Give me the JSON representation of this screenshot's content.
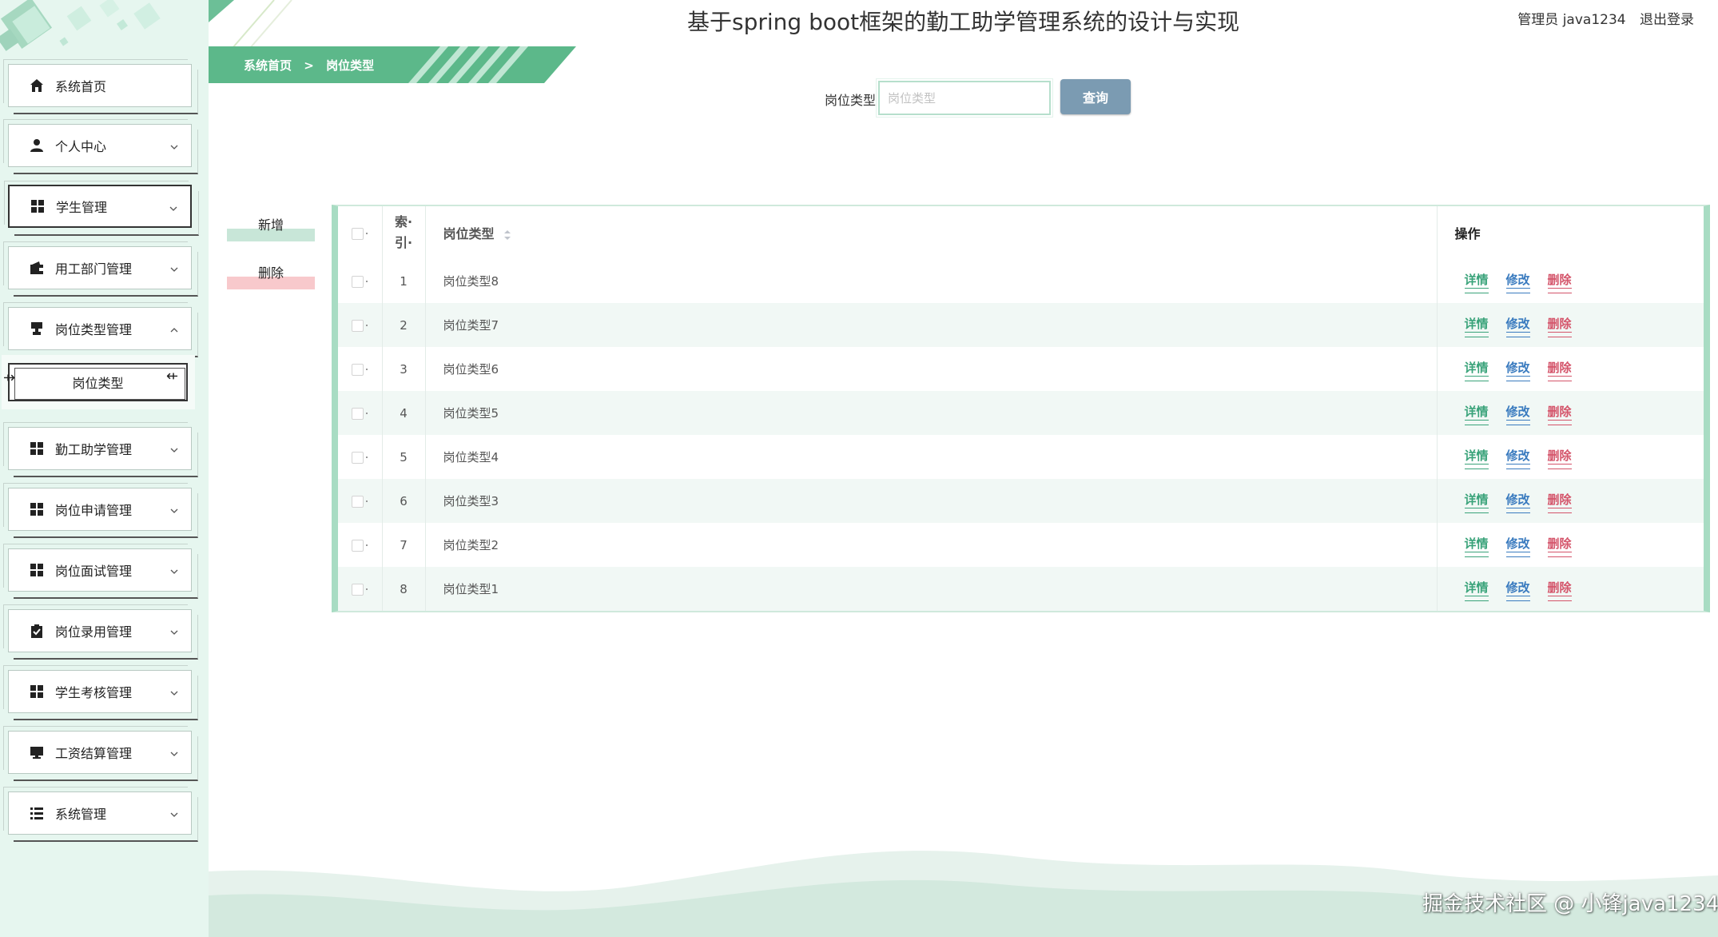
{
  "header": {
    "title": "基于spring boot框架的勤工助学管理系统的设计与实现",
    "user_label": "管理员 java1234",
    "logout_label": "退出登录"
  },
  "sidebar": {
    "items": [
      {
        "label": "系统首页",
        "icon": "home-icon",
        "chevron": ""
      },
      {
        "label": "个人中心",
        "icon": "user-icon",
        "chevron": "down"
      },
      {
        "label": "学生管理",
        "icon": "grid-icon",
        "chevron": "down"
      },
      {
        "label": "用工部门管理",
        "icon": "wallet-icon",
        "chevron": "down"
      },
      {
        "label": "岗位类型管理",
        "icon": "stamp-icon",
        "chevron": "up"
      },
      {
        "label": "勤工助学管理",
        "icon": "grid-icon",
        "chevron": "down"
      },
      {
        "label": "岗位申请管理",
        "icon": "grid-icon",
        "chevron": "down"
      },
      {
        "label": "岗位面试管理",
        "icon": "grid-icon",
        "chevron": "down"
      },
      {
        "label": "岗位录用管理",
        "icon": "clipboard-check-icon",
        "chevron": "down"
      },
      {
        "label": "学生考核管理",
        "icon": "grid-icon",
        "chevron": "down"
      },
      {
        "label": "工资结算管理",
        "icon": "monitor-icon",
        "chevron": "down"
      },
      {
        "label": "系统管理",
        "icon": "list-icon",
        "chevron": "down"
      }
    ],
    "submenu": {
      "label": "岗位类型"
    }
  },
  "breadcrumb": {
    "home": "系统首页",
    "separator": ">",
    "current": "岗位类型"
  },
  "search": {
    "label": "岗位类型",
    "placeholder": "岗位类型",
    "value": "",
    "button_label": "查询"
  },
  "actions": {
    "add_label": "新增",
    "delete_label": "删除"
  },
  "table": {
    "headers": {
      "index_line1": "索·",
      "index_line2": "引·",
      "name": "岗位类型",
      "ops": "操作"
    },
    "op_labels": {
      "detail": "详情",
      "edit": "修改",
      "delete": "删除"
    },
    "rows": [
      {
        "index": "1",
        "name": "岗位类型8"
      },
      {
        "index": "2",
        "name": "岗位类型7"
      },
      {
        "index": "3",
        "name": "岗位类型6"
      },
      {
        "index": "4",
        "name": "岗位类型5"
      },
      {
        "index": "5",
        "name": "岗位类型4"
      },
      {
        "index": "6",
        "name": "岗位类型3"
      },
      {
        "index": "7",
        "name": "岗位类型2"
      },
      {
        "index": "8",
        "name": "岗位类型1"
      }
    ]
  },
  "watermark": "掘金技术社区 @ 小锋java1234",
  "colors": {
    "sidebar_bg": "#e6f6ef",
    "breadcrumb_bg": "#5cb88a",
    "search_button": "#7b9bb2",
    "op_detail": "#3aa37a",
    "op_edit": "#3a7bbf",
    "op_delete": "#d4546a"
  }
}
